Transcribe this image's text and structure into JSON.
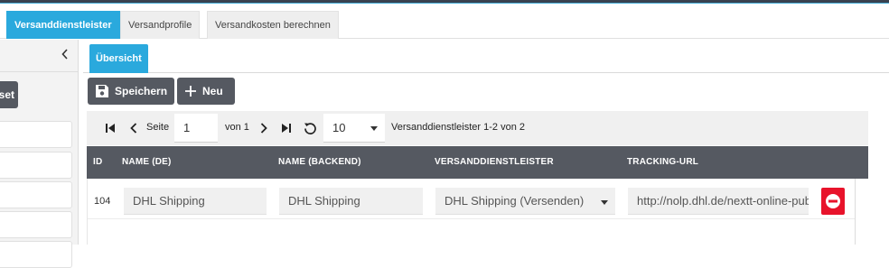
{
  "tabs": [
    {
      "label": "Versanddienstleister",
      "active": true
    },
    {
      "label": "Versandprofile",
      "active": false
    },
    {
      "label": "Versandkosten berechnen",
      "active": false
    }
  ],
  "sidebar": {
    "preset_button_partial": "set"
  },
  "subtab": {
    "label": "Übersicht"
  },
  "toolbar": {
    "save_label": "Speichern",
    "new_label": "Neu"
  },
  "pager": {
    "page_label": "Seite",
    "page_value": "1",
    "of_label": "von 1",
    "per_page": "10",
    "summary": "Versanddienstleister  1-2 von 2"
  },
  "table": {
    "headers": [
      "ID",
      "NAME (DE)",
      "NAME (BACKEND)",
      "VERSANDDIENSTLEISTER",
      "TRACKING-URL"
    ],
    "rows": [
      {
        "id": "104",
        "name_de": "DHL Shipping",
        "name_backend": "DHL Shipping",
        "provider": "DHL Shipping (Versenden)",
        "tracking_url": "http://nolp.dhl.de/nextt-online-public"
      }
    ]
  },
  "colors": {
    "accent": "#2aa9dd",
    "dark_button": "#555961",
    "danger": "#e8132b"
  },
  "icons": [
    "floppy-disk-icon",
    "plus-icon",
    "first-page-icon",
    "prev-page-icon",
    "next-page-icon",
    "last-page-icon",
    "refresh-icon",
    "chevron-left-icon",
    "minus-circle-icon"
  ]
}
